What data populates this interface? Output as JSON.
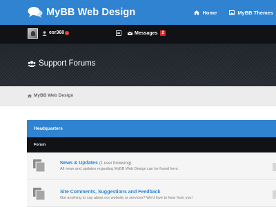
{
  "header": {
    "site_title": "MyBB Web Design",
    "nav": [
      {
        "label": "Home",
        "icon": "home-icon"
      },
      {
        "label": "MyBB Themes",
        "icon": "image-icon"
      }
    ]
  },
  "userbar": {
    "username": "esr360",
    "messages_label": "Messages",
    "messages_count": "2"
  },
  "banner": {
    "title": "Support Forums",
    "icon": "users-icon"
  },
  "breadcrumb": {
    "label": "MyBB Web Design",
    "icon": "home-icon"
  },
  "forum_table": {
    "category": "Headquarters",
    "column_header": "Forum",
    "forums": [
      {
        "title": "News & Updates",
        "browsing": "(1 user browsing)",
        "description": "All news and updates regarding MyBB Web Design can be found here."
      },
      {
        "title": "Site Comments, Suggestions and Feedback",
        "browsing": "",
        "description": "Got anything to say about our website or services? We'd love to hear from you!"
      }
    ]
  },
  "colors": {
    "accent": "#2f83d1",
    "dark_bar": "#101215",
    "badge_red": "#d62d28"
  }
}
